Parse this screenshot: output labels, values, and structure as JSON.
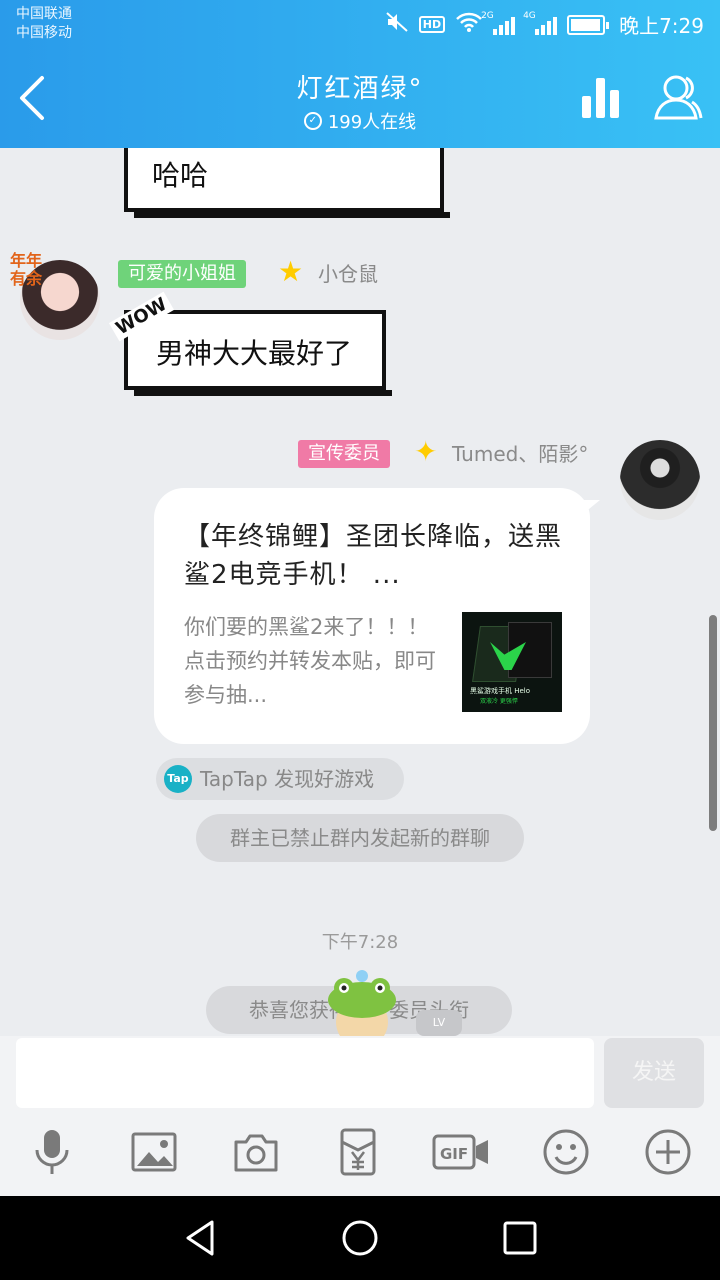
{
  "status_bar": {
    "carrier_1": "中国联通",
    "carrier_2": "中国移动",
    "time": "晚上7:29",
    "signal_1_label": "2G",
    "signal_2_label": "4G",
    "hd_label": "HD"
  },
  "header": {
    "title": "灯红酒绿°",
    "online": "199人在线"
  },
  "messages": {
    "prev_text": "哈哈",
    "msg1": {
      "tag": "可爱的小姐姐",
      "nickname": "小仓鼠",
      "text": "男神大大最好了",
      "wow": "WOW",
      "avatar_text": "年年有余"
    },
    "msg2": {
      "tag": "宣传委员",
      "nickname": "Tumed、陌影°",
      "card_title": "【年终锦鲤】圣团长降临，送黑鲨2电竞手机！ ...",
      "card_desc": "你们要的黑鲨2来了！！！点击预约并转发本贴，即可参与抽...",
      "thumb_title": "黑鲨游戏手机 Helo",
      "thumb_sub": "双液冷 更强悍",
      "source_icon": "Tap",
      "source": "TapTap 发现好游戏"
    },
    "system_notice": "群主已禁止群内发起新的群聊",
    "time": "下午7:28",
    "congrats": "恭喜您获得宣传委员头衔",
    "level_badge": "LV"
  },
  "input": {
    "value": "",
    "send_label": "发送"
  },
  "toolbar_icons": [
    "microphone-icon",
    "image-icon",
    "camera-icon",
    "red-packet-icon",
    "gif-icon",
    "emoji-icon",
    "plus-icon"
  ],
  "colors": {
    "header_gradient_start": "#2a9bea",
    "header_gradient_end": "#39c1f5",
    "tag_green": "#6fd37a",
    "tag_pink": "#f07aa6",
    "star": "#ffcc00",
    "tap_teal": "#19b1c6"
  }
}
